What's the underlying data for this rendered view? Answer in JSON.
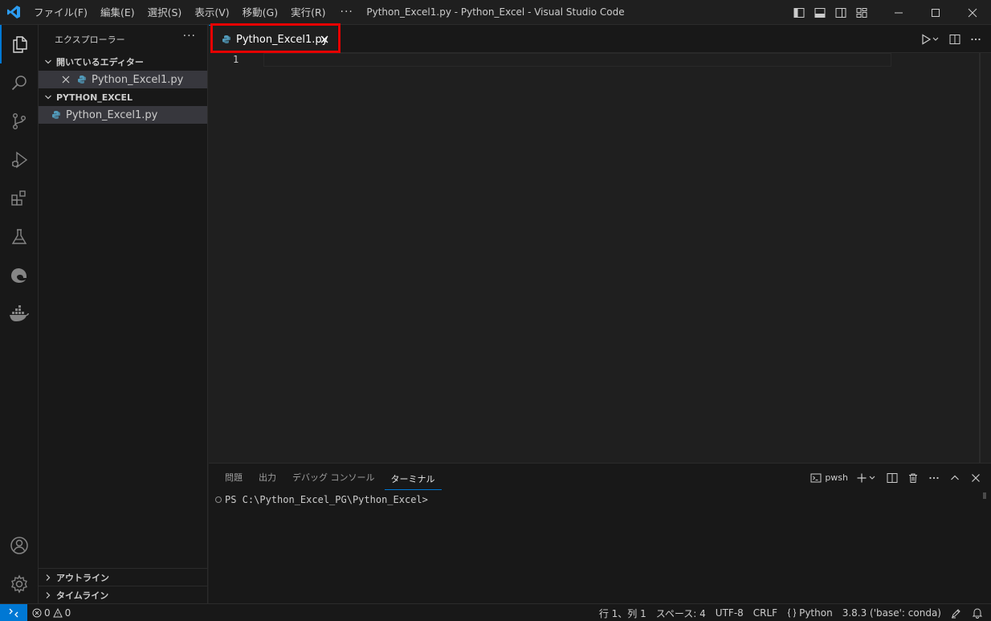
{
  "titlebar": {
    "menus": [
      "ファイル(F)",
      "編集(E)",
      "選択(S)",
      "表示(V)",
      "移動(G)",
      "実行(R)"
    ],
    "more": "···",
    "window_title": "Python_Excel1.py - Python_Excel - Visual Studio Code"
  },
  "sidebar": {
    "title": "エクスプローラー",
    "more": "···",
    "open_editors": {
      "label": "開いているエディター",
      "files": [
        "Python_Excel1.py"
      ]
    },
    "workspace": {
      "label": "PYTHON_EXCEL",
      "files": [
        "Python_Excel1.py"
      ]
    },
    "outline_label": "アウトライン",
    "timeline_label": "タイムライン"
  },
  "editor": {
    "tab_label": "Python_Excel1.py",
    "line_numbers": [
      "1"
    ]
  },
  "panel": {
    "tabs": [
      "問題",
      "出力",
      "デバッグ コンソール",
      "ターミナル"
    ],
    "active_tab": "ターミナル",
    "shell_label": "pwsh",
    "terminal_prompt": "PS C:\\Python_Excel_PG\\Python_Excel>"
  },
  "statusbar": {
    "errors": "0",
    "warnings": "0",
    "cursor": "行 1、列 1",
    "spaces": "スペース: 4",
    "encoding": "UTF-8",
    "eol": "CRLF",
    "language": "Python",
    "interpreter": "3.8.3 ('base': conda)"
  },
  "colors": {
    "accent": "#0078d4",
    "highlight": "#e60000",
    "python_icon": "#519aba"
  }
}
